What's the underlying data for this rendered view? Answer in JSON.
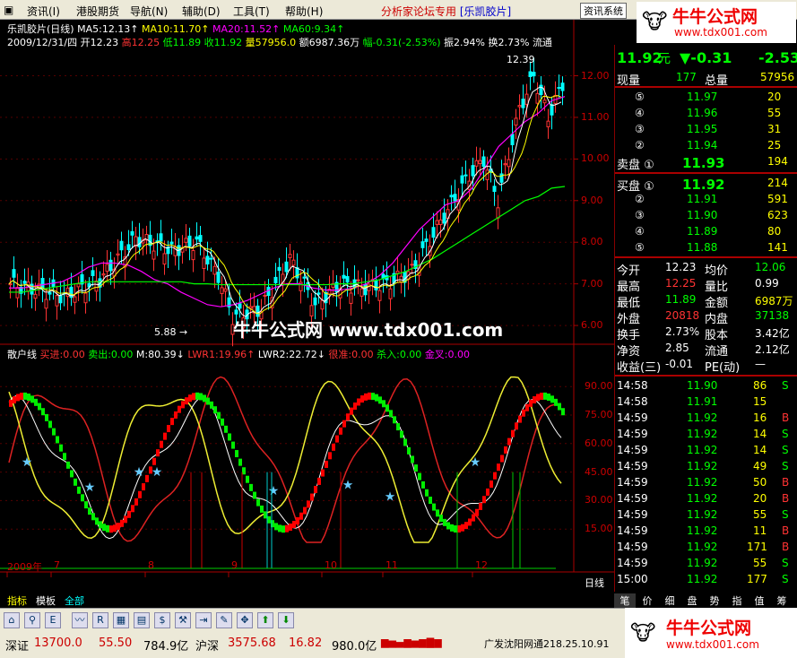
{
  "menu": {
    "items": [
      "资讯(I)",
      "港股期货",
      "导航(N)",
      "辅助(D)",
      "工具(T)",
      "帮助(H)"
    ],
    "title": "分析家论坛专用",
    "stock_tag": "[乐凯胶片]",
    "system": "资讯系统"
  },
  "logo": {
    "name": "牛牛公式网",
    "url": "www.tdx001.com"
  },
  "watermark": "牛牛公式网 www.tdx001.com",
  "chart_header": {
    "line1": [
      [
        "乐凯胶片(日线)",
        "#fff"
      ],
      [
        "MA5:12.13↑",
        "#fff"
      ],
      [
        "MA10:11.70↑",
        "#ff0"
      ],
      [
        "MA20:11.52↑",
        "#f0f"
      ],
      [
        "MA60:9.34↑",
        "#0f0"
      ]
    ],
    "line2": [
      [
        "2009/12/31/四 开12.23",
        "#fff"
      ],
      [
        "高12.25",
        "#f33"
      ],
      [
        "低11.89",
        "#0f0"
      ],
      [
        "收11.92",
        "#0f0"
      ],
      [
        "量57956.0",
        "#ff0"
      ],
      [
        "额6987.36万",
        "#fff"
      ],
      [
        "幅-0.31(-2.53%)",
        "#0f0"
      ],
      [
        "振2.94%",
        "#fff"
      ],
      [
        "换2.73%",
        "#fff"
      ],
      [
        "流通",
        "#fff"
      ]
    ]
  },
  "price_axis": [
    "12.00",
    "11.00",
    "10.00",
    "9.00",
    "8.00",
    "7.00",
    "6.00"
  ],
  "annotations": {
    "high": "12.39",
    "low": "5.88"
  },
  "indicator": {
    "header": [
      [
        "散户线",
        "#fff"
      ],
      [
        "买进:0.00",
        "#f33"
      ],
      [
        "卖出:0.00",
        "#0f0"
      ],
      [
        "M:80.39↓",
        "#fff"
      ],
      [
        "LWR1:19.96↑",
        "#f33"
      ],
      [
        "LWR2:22.72↓",
        "#fff"
      ],
      [
        "很准:0.00",
        "#f33"
      ],
      [
        "杀入:0.00",
        "#0f0"
      ],
      [
        "金叉:0.00",
        "#f0f"
      ]
    ],
    "axis": [
      "90.00",
      "75.00",
      "60.00",
      "45.00",
      "30.00",
      "15.00"
    ]
  },
  "date_axis": {
    "labels": [
      "2009年",
      "7",
      "8",
      "9",
      "10",
      "11",
      "12"
    ],
    "period": "日线"
  },
  "chart_data": {
    "type": "line",
    "ylim": [
      5.7,
      12.7
    ],
    "series": [
      {
        "name": "MA20",
        "color": "#f0f",
        "values": [
          6.9,
          6.9,
          6.95,
          7.0,
          7.05,
          7.2,
          7.4,
          7.5,
          7.5,
          7.45,
          7.3,
          7.1,
          7.0,
          6.8,
          6.65,
          6.5,
          6.45,
          6.5,
          6.6,
          6.75,
          6.9,
          7.0,
          7.0,
          6.9,
          6.85,
          6.85,
          6.9,
          7.0,
          7.2,
          7.5,
          7.9,
          8.3,
          8.6,
          8.9,
          9.0,
          9.3,
          9.8,
          10.3,
          10.6,
          10.9,
          11.1,
          11.4,
          11.5
        ]
      },
      {
        "name": "MA60",
        "color": "#0f0",
        "values": [
          6.8,
          6.8,
          6.85,
          6.9,
          6.95,
          7.0,
          7.05,
          7.05,
          7.05,
          7.05,
          7.05,
          7.05,
          7.05,
          7.05,
          7.0,
          7.0,
          6.98,
          6.98,
          6.98,
          6.98,
          6.98,
          6.98,
          6.98,
          6.98,
          6.98,
          7.0,
          7.0,
          7.05,
          7.1,
          7.2,
          7.3,
          7.45,
          7.6,
          7.8,
          8.0,
          8.2,
          8.4,
          8.6,
          8.8,
          9.0,
          9.1,
          9.3,
          9.34
        ]
      }
    ]
  },
  "quote": {
    "price": "11.92",
    "unit": "元",
    "change": "▼-0.31",
    "pct": "-2.53",
    "now_vol": "177",
    "total_vol": "57956",
    "now_vol_label": "现量",
    "total_vol_label": "总量"
  },
  "asks": [
    {
      "label": "⑤",
      "price": "11.97",
      "vol": "20"
    },
    {
      "label": "④",
      "price": "11.96",
      "vol": "55"
    },
    {
      "label": "③",
      "price": "11.95",
      "vol": "31"
    },
    {
      "label": "②",
      "price": "11.94",
      "vol": "25"
    },
    {
      "label": "卖盘 ①",
      "price": "11.93",
      "vol": "194"
    }
  ],
  "bids": [
    {
      "label": "买盘 ①",
      "price": "11.92",
      "vol": "214"
    },
    {
      "label": "②",
      "price": "11.91",
      "vol": "591"
    },
    {
      "label": "③",
      "price": "11.90",
      "vol": "623"
    },
    {
      "label": "④",
      "price": "11.89",
      "vol": "80"
    },
    {
      "label": "⑤",
      "price": "11.88",
      "vol": "141"
    }
  ],
  "stats": [
    [
      "今开",
      "12.23",
      "#fff",
      "均价",
      "12.06",
      "#0f0"
    ],
    [
      "最高",
      "12.25",
      "#f33",
      "量比",
      "0.99",
      "#fff"
    ],
    [
      "最低",
      "11.89",
      "#0f0",
      "金额",
      "6987万",
      "#ff0"
    ],
    [
      "外盘",
      "20818",
      "#f33",
      "内盘",
      "37138",
      "#0f0"
    ],
    [
      "换手",
      "2.73%",
      "#fff",
      "股本",
      "3.42亿",
      "#fff"
    ],
    [
      "净资",
      "2.85",
      "#fff",
      "流通",
      "2.12亿",
      "#fff"
    ],
    [
      "收益(三)",
      "-0.01",
      "#fff",
      "PE(动)",
      "—",
      "#fff"
    ]
  ],
  "ticks": [
    [
      "14:58",
      "11.90",
      "86",
      "S"
    ],
    [
      "14:58",
      "11.91",
      "15",
      ""
    ],
    [
      "14:59",
      "11.92",
      "16",
      "B"
    ],
    [
      "14:59",
      "11.92",
      "14",
      "S"
    ],
    [
      "14:59",
      "11.92",
      "14",
      "S"
    ],
    [
      "14:59",
      "11.92",
      "49",
      "S"
    ],
    [
      "14:59",
      "11.92",
      "50",
      "B"
    ],
    [
      "14:59",
      "11.92",
      "20",
      "B"
    ],
    [
      "14:59",
      "11.92",
      "55",
      "S"
    ],
    [
      "14:59",
      "11.92",
      "11",
      "B"
    ],
    [
      "14:59",
      "11.92",
      "171",
      "B"
    ],
    [
      "14:59",
      "11.92",
      "55",
      "S"
    ],
    [
      "15:00",
      "11.92",
      "177",
      "S"
    ]
  ],
  "right_tabs": [
    "笔",
    "价",
    "细",
    "盘",
    "势",
    "指",
    "值",
    "筹"
  ],
  "left_tabs": [
    [
      "指标",
      "#ff0"
    ],
    [
      "模板",
      "#fff"
    ],
    [
      "全部",
      "#0ff"
    ]
  ],
  "status": {
    "sz_label": "深证",
    "sz": "13700.0",
    "sz_chg": "55.50",
    "sz_amt": "784.9亿",
    "hs_label": "沪深",
    "hs": "3575.68",
    "hs_chg": "16.82",
    "hs_amt": "980.0亿",
    "broker": "广发沈阳网通218.25.10.91"
  },
  "colors": {
    "up": "#ff3333",
    "down": "#00ff00",
    "grid": "#800000"
  }
}
